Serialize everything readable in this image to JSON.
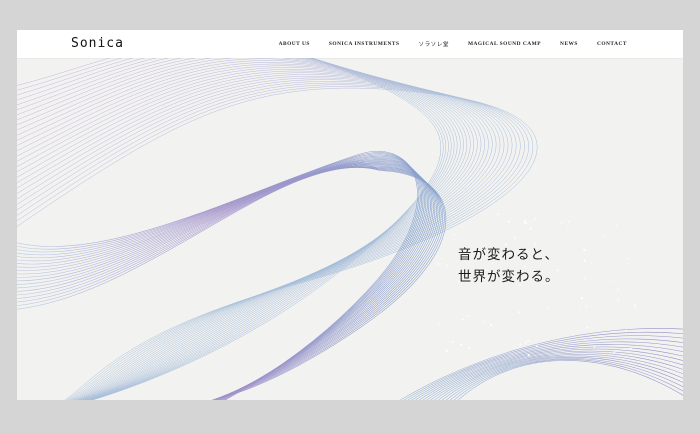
{
  "brand": {
    "logo_text": "Sonica"
  },
  "nav": {
    "items": [
      {
        "label": "ABOUT US"
      },
      {
        "label": "SONICA INSTRUMENTS"
      },
      {
        "label": "ソラソレ堂"
      },
      {
        "label": "MAGICAL SOUND CAMP"
      },
      {
        "label": "NEWS"
      },
      {
        "label": "CONTACT"
      }
    ]
  },
  "hero": {
    "line1": "音が変わると、",
    "line2": "世界が変わる。"
  },
  "colors": {
    "page_bg": "#d4d5d4",
    "frame_bg": "#f2f2f1",
    "wave_purple": "#9b86c7",
    "wave_blue": "#7fa6c9"
  }
}
